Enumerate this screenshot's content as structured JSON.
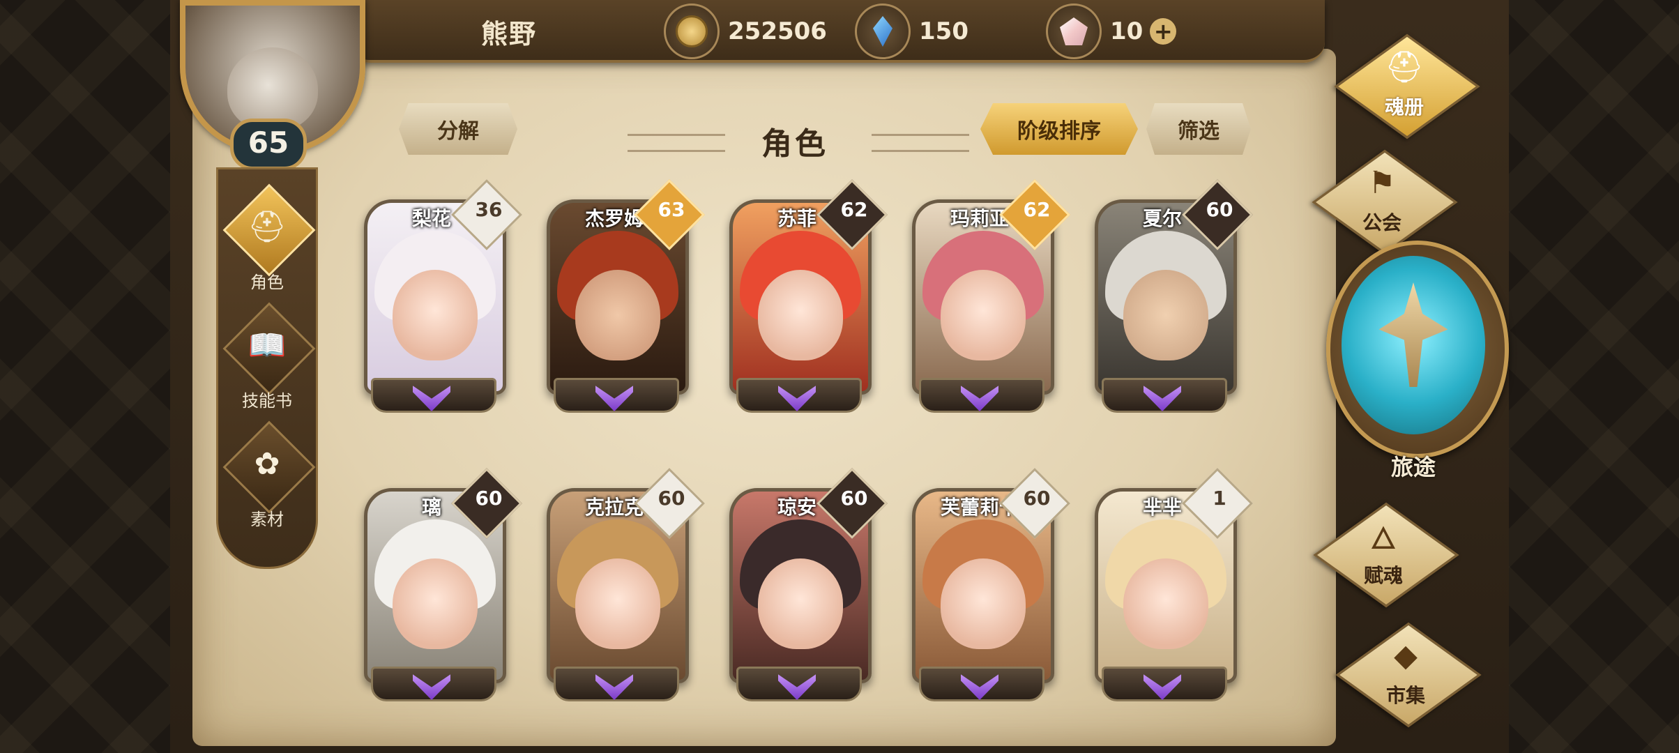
{
  "header": {
    "player_name": "熊野",
    "player_level": "65",
    "resources": [
      {
        "icon": "gold-coin-icon",
        "value": "252506"
      },
      {
        "icon": "blue-crystal-icon",
        "value": "150"
      },
      {
        "icon": "pink-crystal-icon",
        "value": "10"
      }
    ],
    "add_symbol": "+"
  },
  "left_nav": [
    {
      "label": "角色",
      "icon": "helmet-icon",
      "active": true
    },
    {
      "label": "技能书",
      "icon": "skill-book-icon",
      "active": false
    },
    {
      "label": "素材",
      "icon": "material-icon",
      "active": false
    }
  ],
  "toolbar": {
    "decompose": "分解",
    "title": "角色",
    "sort": "阶级排序",
    "filter": "筛选"
  },
  "characters": [
    {
      "name": "梨花",
      "level": "36",
      "badge": "light"
    },
    {
      "name": "杰罗姆",
      "level": "63",
      "badge": "gold"
    },
    {
      "name": "苏菲",
      "level": "62",
      "badge": "dark"
    },
    {
      "name": "玛莉亚",
      "level": "62",
      "badge": "gold"
    },
    {
      "name": "夏尔",
      "level": "60",
      "badge": "dark"
    },
    {
      "name": "璃",
      "level": "60",
      "badge": "dark"
    },
    {
      "name": "克拉克",
      "level": "60",
      "badge": "light"
    },
    {
      "name": "琼安",
      "level": "60",
      "badge": "dark"
    },
    {
      "name": "芙蕾莉卡",
      "level": "60",
      "badge": "light"
    },
    {
      "name": "芈芈",
      "level": "1",
      "badge": "light"
    }
  ],
  "right_menu": {
    "soul_book": "魂册",
    "guild": "公会",
    "journey": "旅途",
    "talent": "赋魂",
    "market": "市集"
  }
}
